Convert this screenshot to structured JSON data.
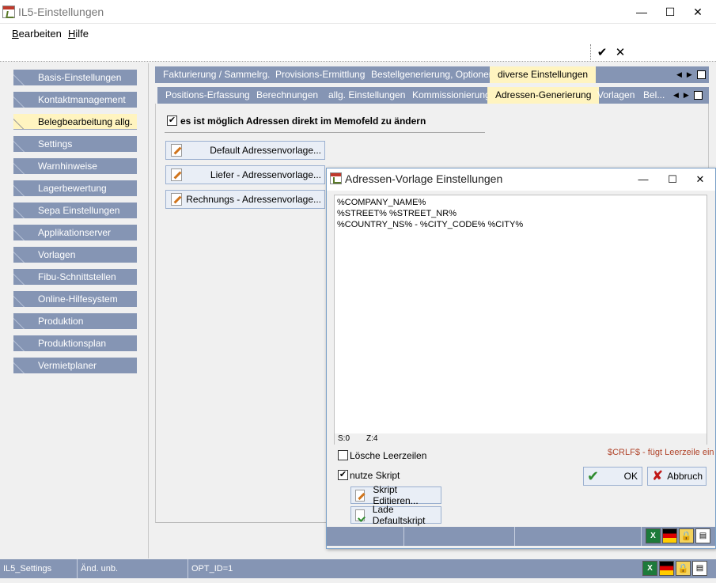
{
  "window": {
    "title": "IL5-Einstellungen",
    "minimize": "—",
    "maximize": "☐",
    "close": "✕"
  },
  "menu": {
    "edit": "Bearbeiten",
    "edit_u": "B",
    "edit_rest": "earbeiten",
    "help_u": "H",
    "help_rest": "ilfe"
  },
  "toolbar": {
    "confirm": "✔",
    "cancel": "✕"
  },
  "sidebar": {
    "items": [
      {
        "label": "Basis-Einstellungen"
      },
      {
        "label": "Kontaktmanagement"
      },
      {
        "label": "Belegbearbeitung allg.",
        "active": true
      },
      {
        "label": "Settings"
      },
      {
        "label": "Warnhinweise"
      },
      {
        "label": "Lagerbewertung"
      },
      {
        "label": "Sepa Einstellungen"
      },
      {
        "label": "Applikationserver"
      },
      {
        "label": "Vorlagen"
      },
      {
        "label": "Fibu-Schnittstellen"
      },
      {
        "label": "Online-Hilfesystem"
      },
      {
        "label": "Produktion"
      },
      {
        "label": "Produktionsplan"
      },
      {
        "label": "Vermietplaner"
      }
    ]
  },
  "tabs_top": [
    {
      "label": "Fakturierung / Sammelrg."
    },
    {
      "label": "Provisions-Ermittlung"
    },
    {
      "label": "Bestellgenerierung, Optionen"
    },
    {
      "label": "diverse Einstellungen",
      "active": true
    }
  ],
  "tabs_sub": [
    {
      "label": "Positions-Erfassung"
    },
    {
      "label": "Berechnungen"
    },
    {
      "label": "allg. Einstellungen"
    },
    {
      "label": "Kommissionierung"
    },
    {
      "label": "Adressen-Generierung",
      "active": true
    },
    {
      "label": "Vorlagen"
    },
    {
      "label": "Bel..."
    }
  ],
  "content": {
    "memo_checkbox_label": "es ist möglich Adressen direkt im Memofeld zu ändern",
    "memo_checked": true,
    "buttons": [
      {
        "label": "Default Adressenvorlage..."
      },
      {
        "label": "Liefer - Adressenvorlage..."
      },
      {
        "label": "Rechnungs - Adressenvorlage..."
      }
    ]
  },
  "dialog": {
    "title": "Adressen-Vorlage Einstellungen",
    "memo_lines": [
      "%COMPANY_NAME%",
      "%STREET% %STREET_NR%",
      "%COUNTRY_NS% - %CITY_CODE% %CITY%"
    ],
    "status_s": "S:0",
    "status_z": "Z:4",
    "delete_empty_lines": "Lösche Leerzeilen",
    "delete_empty_checked": false,
    "hint": "$CRLF$ - fügt Leerzeile ein",
    "use_script": "nutze Skript",
    "use_script_checked": true,
    "edit_script": "Skript Editieren...",
    "load_default_script": "Lade Defaultskript",
    "ok": "OK",
    "cancel": "Abbruch"
  },
  "statusbar": {
    "module": "IL5_Settings",
    "changed": "Änd. unb.",
    "opt": "OPT_ID=1"
  },
  "icons": {
    "excel": "X",
    "lock": "🔒",
    "print": "▤"
  }
}
